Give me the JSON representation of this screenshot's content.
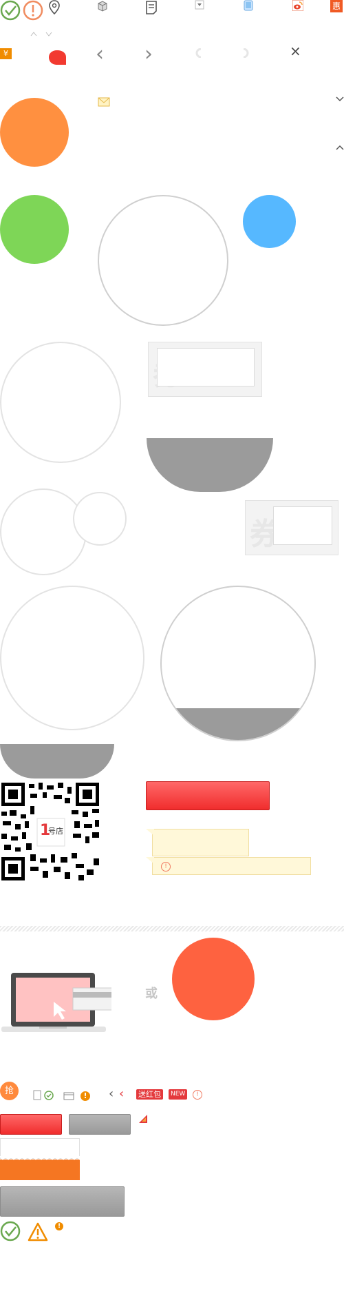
{
  "sprite": {
    "badge_hui": "惠",
    "badge_yen": "¥",
    "coupon_word": "券",
    "or_label": "或",
    "rob_label": "抢",
    "hongbao_tag": "送红包",
    "new_tag": "NEW",
    "qr_logo_num": "1",
    "qr_logo_text": "号店",
    "arrow_left": "‹",
    "arrow_right": "›",
    "close": "×",
    "small_left": "‹",
    "warn_mark": "!",
    "colors": {
      "orange": "#ff9040",
      "green": "#7ed657",
      "blue": "#56b8ff",
      "tomato": "#fe6240",
      "red": "#f02d2d",
      "grey": "#9b9b9b"
    }
  }
}
